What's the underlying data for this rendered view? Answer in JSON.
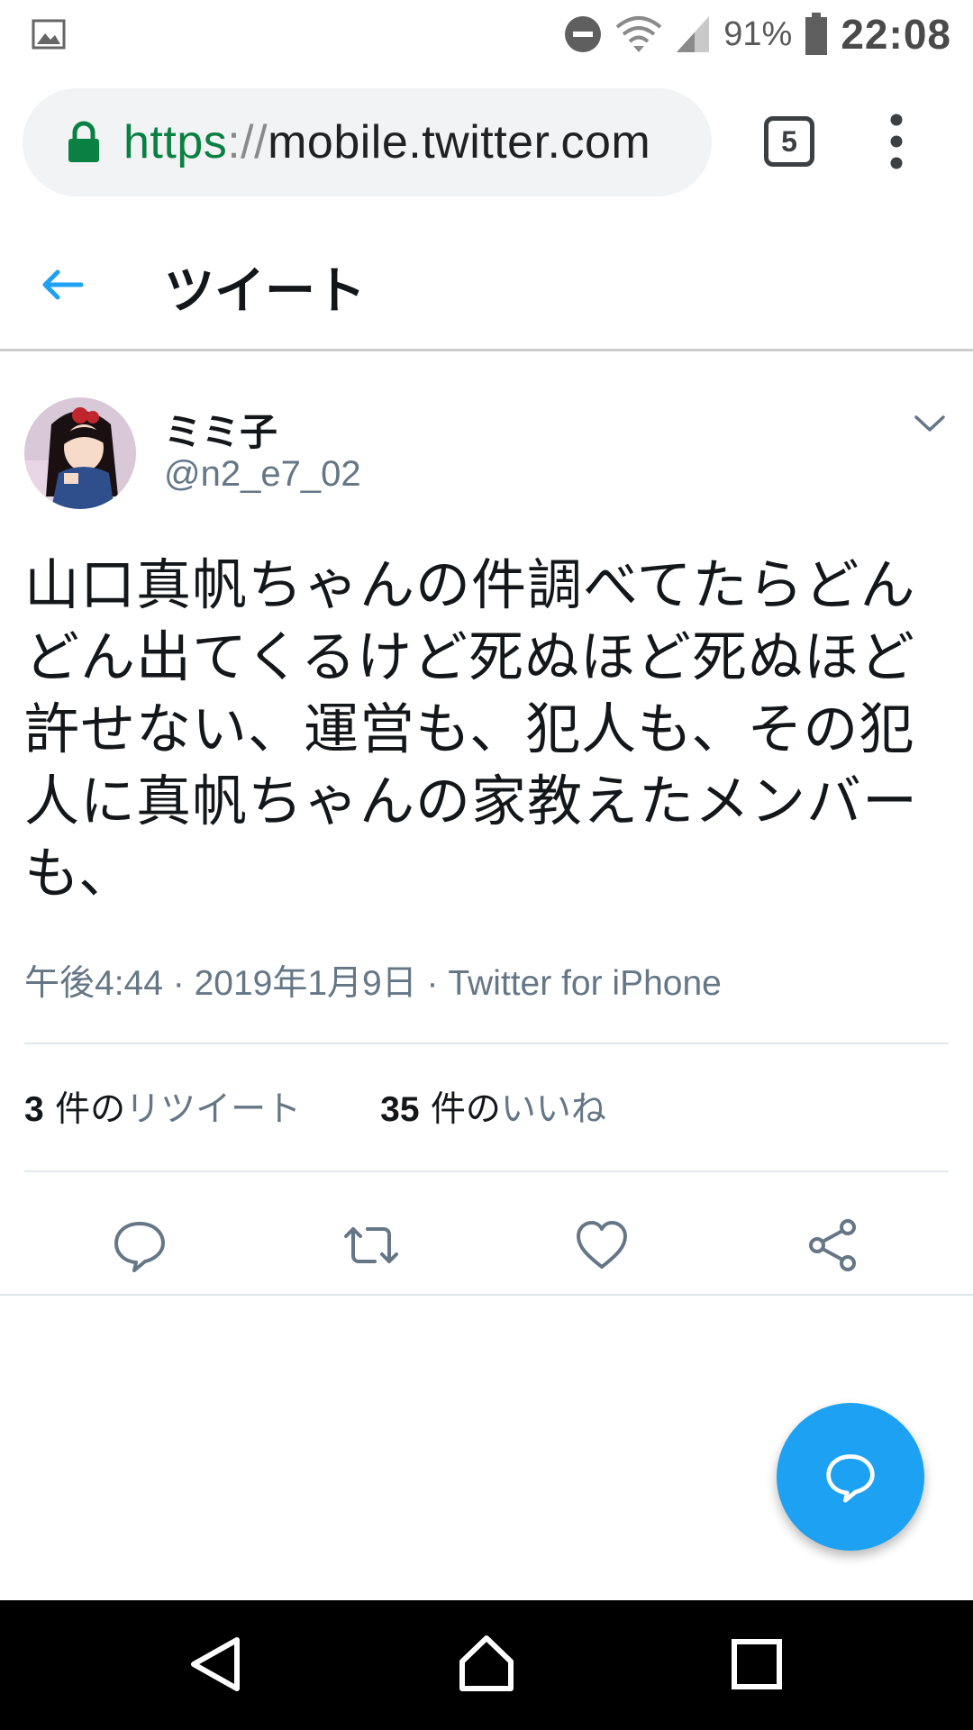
{
  "status_bar": {
    "battery_percent": "91%",
    "time": "22:08",
    "icons": [
      "image-notification-icon",
      "do-not-disturb-icon",
      "wifi-icon",
      "cell-signal-icon",
      "battery-icon"
    ]
  },
  "browser": {
    "url_scheme": "https",
    "url_separator": "://",
    "url_host": "mobile.twitter.com",
    "tab_count": "5"
  },
  "header": {
    "title": "ツイート"
  },
  "tweet": {
    "display_name": "ミミ子",
    "handle": "@n2_e7_02",
    "text": "山口真帆ちゃんの件調べてたらどんどん出てくるけど死ぬほど死ぬほど許せない、運営も、犯人も、その犯人に真帆ちゃんの家教えたメンバーも、",
    "time": "午後4:44",
    "date": "2019年1月9日",
    "source": "Twitter for iPhone",
    "meta_separator": " · ",
    "retweets": {
      "count": "3",
      "prefix": " 件の",
      "label": "リツイート"
    },
    "likes": {
      "count": "35",
      "prefix": " 件の",
      "label": "いいね"
    }
  },
  "colors": {
    "accent": "#1da1f2",
    "secondary_text": "#657786",
    "primary_text": "#14171a",
    "url_secure_green": "#0b8043"
  }
}
